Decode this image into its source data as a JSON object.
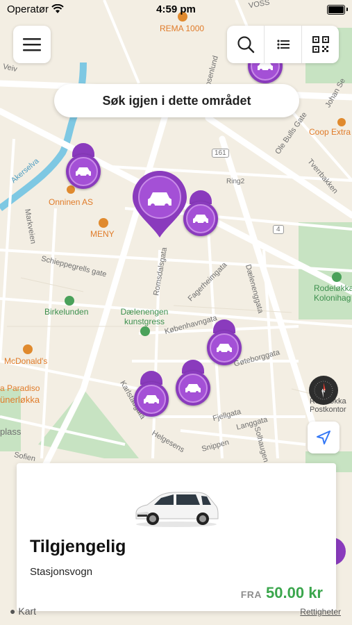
{
  "status_bar": {
    "carrier": "Operatør",
    "time": "4:59 pm"
  },
  "search_again": {
    "label": "Søk igjen i dette området"
  },
  "map": {
    "street_labels": [
      {
        "text": "Akerselva"
      },
      {
        "text": "Schieppegrells gate"
      },
      {
        "text": "Romsdalsgata"
      },
      {
        "text": "Fagerheimgata"
      },
      {
        "text": "Dælenenggata"
      },
      {
        "text": "Københavngata"
      },
      {
        "text": "Gøteborggata"
      },
      {
        "text": "Karlstadgata"
      },
      {
        "text": "Fjellgata"
      },
      {
        "text": "Langgata"
      },
      {
        "text": "Snippen"
      },
      {
        "text": "Solhaugen"
      },
      {
        "text": "Helgesens"
      },
      {
        "text": "Markveien"
      },
      {
        "text": "Ole Bulls Gate"
      },
      {
        "text": "Tverrbakken"
      },
      {
        "text": "Rosenlund"
      },
      {
        "text": "Ring2"
      },
      {
        "text": "161"
      },
      {
        "text": "4"
      },
      {
        "text": "Sofien"
      },
      {
        "text": "Johan Se"
      },
      {
        "text": "Veiv"
      },
      {
        "text": "ünerløkka"
      },
      {
        "text": "plass"
      },
      {
        "text": "VOSS"
      }
    ],
    "poi_labels": [
      {
        "text": "REMA 1000",
        "color": "#e07b29"
      },
      {
        "text": "Coop Extra",
        "color": "#e07b29"
      },
      {
        "text": "Onninen AS",
        "color": "#e07b29"
      },
      {
        "text": "MENY",
        "color": "#e07b29"
      },
      {
        "text": "Birkelunden",
        "color": "#3c8f4d"
      },
      {
        "text": "Dælenengen kunstgress",
        "color": "#3c8f4d"
      },
      {
        "text": "McDonald's",
        "color": "#e07b29"
      },
      {
        "text": "a Paradiso",
        "color": "#e07b29"
      },
      {
        "text": "Rodeløkka Kolonihag",
        "color": "#3c8f4d"
      },
      {
        "text": "Rodeløkka Postkontor",
        "color": "#555"
      }
    ],
    "legal": "Kart",
    "legal_link": "Rettigheter",
    "compass_letter": "N"
  },
  "card": {
    "title": "Tilgjengelig",
    "subtitle": "Stasjonsvogn",
    "price_prefix": "FRA",
    "price": "50.00 kr"
  },
  "colors": {
    "marker": "#8a3bbd",
    "price": "#3aa64c"
  }
}
